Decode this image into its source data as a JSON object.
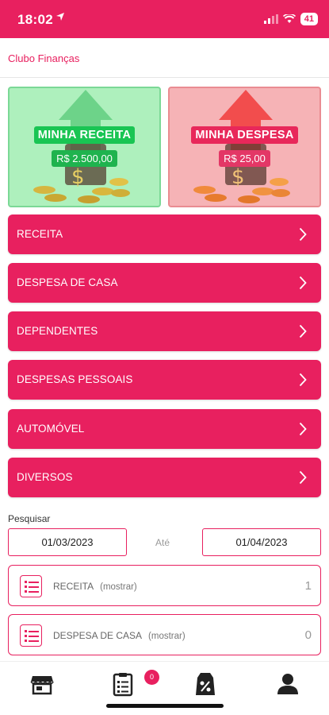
{
  "status": {
    "time": "18:02",
    "battery": "41"
  },
  "header": {
    "title": "Clubo Finanças"
  },
  "cards": {
    "income": {
      "title": "MINHA RECEITA",
      "value": "R$ 2.500,00"
    },
    "expense": {
      "title": "MINHA DESPESA",
      "value": "R$ 25,00"
    }
  },
  "menu": {
    "items": [
      {
        "label": "RECEITA"
      },
      {
        "label": "DESPESA DE CASA"
      },
      {
        "label": "DEPENDENTES"
      },
      {
        "label": "DESPESAS PESSOAIS"
      },
      {
        "label": "AUTOMÓVEL"
      },
      {
        "label": "DIVERSOS"
      }
    ]
  },
  "search": {
    "label": "Pesquisar",
    "from": "01/03/2023",
    "to_label": "Até",
    "to": "01/04/2023"
  },
  "summary": {
    "rows": [
      {
        "name": "RECEITA",
        "show": "(mostrar)",
        "count": "1"
      },
      {
        "name": "DESPESA DE CASA",
        "show": "(mostrar)",
        "count": "0"
      }
    ]
  },
  "tabs": {
    "badge": "0",
    "items": [
      {
        "icon": "store-icon"
      },
      {
        "icon": "clipboard-list-icon"
      },
      {
        "icon": "discount-tag-icon"
      },
      {
        "icon": "user-icon"
      }
    ]
  },
  "colors": {
    "primary": "#E8205F",
    "income_bg": "#AEF0BD",
    "expense_bg": "#F6B3B6",
    "income_badge": "#19C553"
  }
}
